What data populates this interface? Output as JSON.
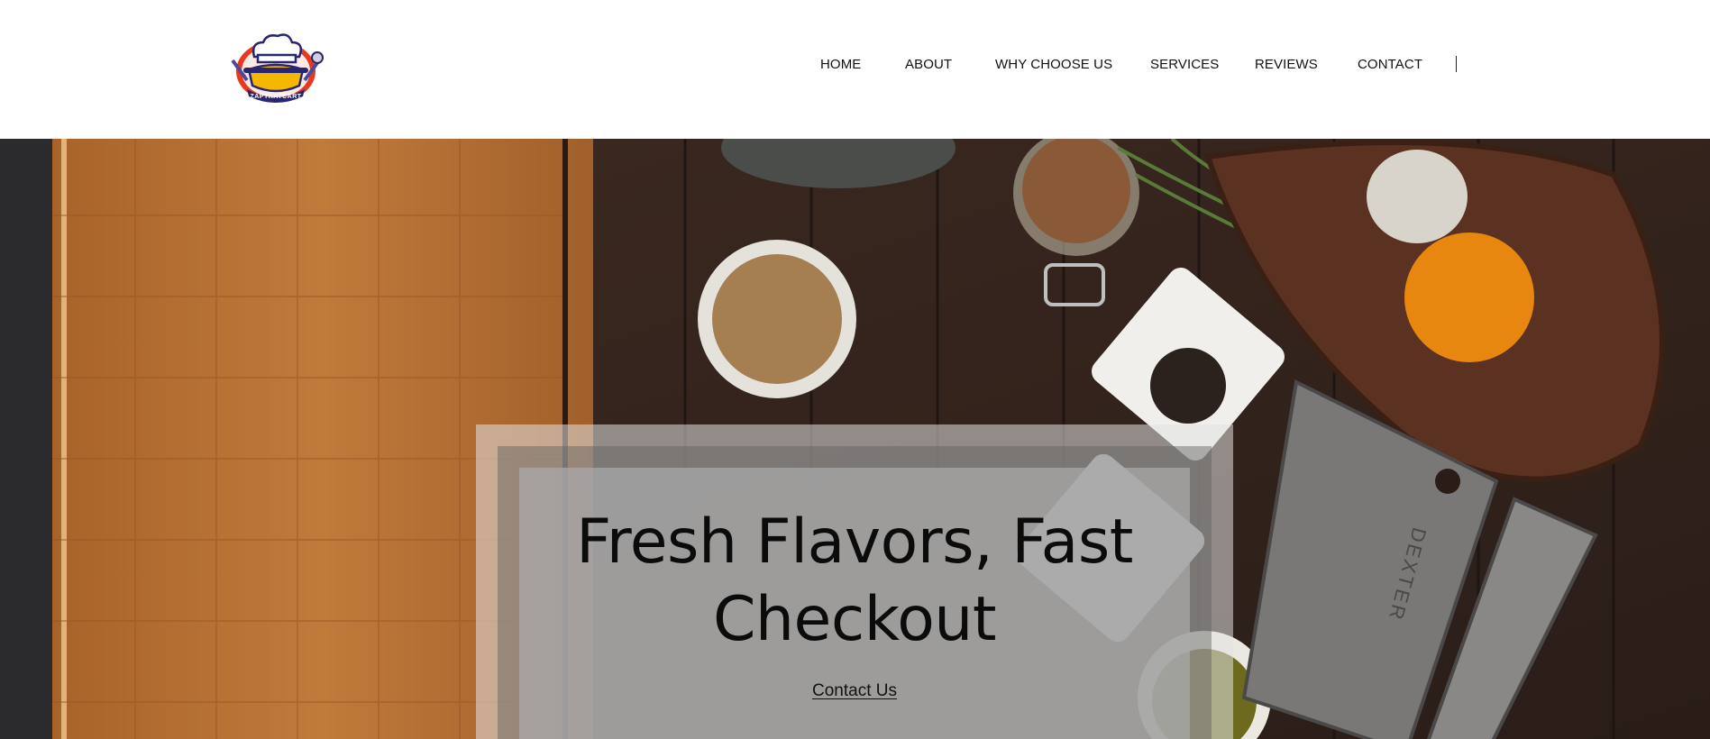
{
  "brand": {
    "logo_icon": "chef-hat-pot-logo",
    "logo_text": "ZAPTHATCART"
  },
  "nav": {
    "items": [
      {
        "label": "HOME"
      },
      {
        "label": "ABOUT"
      },
      {
        "label": "WHY CHOOSE US"
      },
      {
        "label": "SERVICES"
      },
      {
        "label": "REVIEWS"
      },
      {
        "label": "CONTACT"
      }
    ]
  },
  "hero": {
    "title": "Fresh Flavors, Fast Checkout",
    "cta_label": "Contact Us",
    "knife_brand": "DEXTER"
  },
  "colors": {
    "overlay_outer": "#e1e1e1",
    "overlay_mid": "#5f5f5f",
    "overlay_inner": "#aaaaaa",
    "text": "#111111"
  }
}
